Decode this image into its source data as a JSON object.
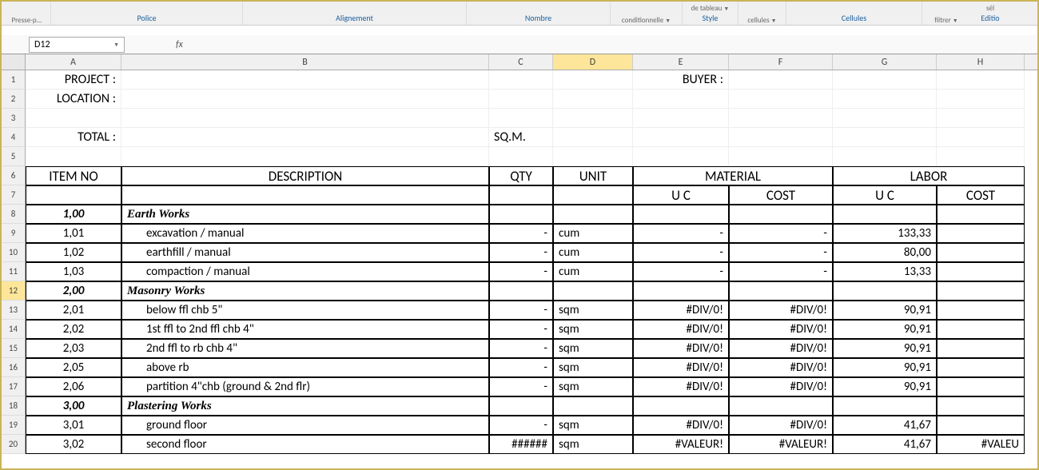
{
  "ribbon": {
    "groups": [
      {
        "top": "Presse-p...",
        "label": ""
      },
      {
        "label": "Police"
      },
      {
        "label": "Alignement"
      },
      {
        "label": "Nombre"
      },
      {
        "top": "conditionnelle",
        "label": ""
      },
      {
        "top": "de tableau",
        "label": "Style"
      },
      {
        "top": "cellules",
        "label": ""
      },
      {
        "label": "Cellules"
      },
      {
        "top": "filtrer",
        "label": ""
      },
      {
        "top": "sél",
        "label": "Editio"
      }
    ]
  },
  "namebox": "D12",
  "fx": "fx",
  "columns": [
    "A",
    "B",
    "C",
    "D",
    "E",
    "F",
    "G",
    "H"
  ],
  "active_col": "D",
  "active_row": 12,
  "header_labels": {
    "project": "PROJECT :",
    "buyer": "BUYER :",
    "location": "LOCATION :",
    "total": "TOTAL :",
    "sqm": "SQ.M."
  },
  "table_headers": {
    "item_no": "ITEM NO",
    "description": "DESCRIPTION",
    "qty": "QTY",
    "unit": "UNIT",
    "material": "MATERIAL",
    "labor": "LABOR",
    "uc": "U C",
    "cost": "COST"
  },
  "rows": [
    {
      "n": "1",
      "a": "PROJECT :",
      "e": "BUYER :"
    },
    {
      "n": "2",
      "a": "LOCATION :"
    },
    {
      "n": "3"
    },
    {
      "n": "4",
      "a": "TOTAL :",
      "c": "SQ.M."
    },
    {
      "n": "5"
    },
    {
      "n": "6",
      "hdr1": true
    },
    {
      "n": "7",
      "hdr2": true
    },
    {
      "n": "8",
      "a": "1,00",
      "b": "Earth Works",
      "section": true
    },
    {
      "n": "9",
      "a": "1,01",
      "b": "excavation / manual",
      "c": "-",
      "d": "cum",
      "e": "-",
      "f": "-",
      "g": "133,33"
    },
    {
      "n": "10",
      "a": "1,02",
      "b": "earthfill / manual",
      "c": "-",
      "d": "cum",
      "e": "-",
      "f": "-",
      "g": "80,00"
    },
    {
      "n": "11",
      "a": "1,03",
      "b": "compaction / manual",
      "c": "-",
      "d": "cum",
      "e": "-",
      "f": "-",
      "g": "13,33"
    },
    {
      "n": "12",
      "a": "2,00",
      "b": "Masonry Works",
      "section": true,
      "active": true
    },
    {
      "n": "13",
      "a": "2,01",
      "b": "below ffl chb 5\"",
      "c": "-",
      "d": "sqm",
      "e": "#DIV/0!",
      "f": "#DIV/0!",
      "g": "90,91"
    },
    {
      "n": "14",
      "a": "2,02",
      "b": "1st ffl to 2nd ffl  chb 4\"",
      "c": "-",
      "d": "sqm",
      "e": "#DIV/0!",
      "f": "#DIV/0!",
      "g": "90,91"
    },
    {
      "n": "15",
      "a": "2,03",
      "b": "2nd ffl to rb chb 4\"",
      "c": "-",
      "d": "sqm",
      "e": "#DIV/0!",
      "f": "#DIV/0!",
      "g": "90,91"
    },
    {
      "n": "16",
      "a": "2,05",
      "b": "above rb",
      "c": "-",
      "d": "sqm",
      "e": "#DIV/0!",
      "f": "#DIV/0!",
      "g": "90,91"
    },
    {
      "n": "17",
      "a": "2,06",
      "b": "partition 4\"chb (ground & 2nd flr)",
      "c": "-",
      "d": "sqm",
      "e": "#DIV/0!",
      "f": "#DIV/0!",
      "g": "90,91"
    },
    {
      "n": "18",
      "a": "3,00",
      "b": "Plastering Works",
      "section": true
    },
    {
      "n": "19",
      "a": "3,01",
      "b": "ground floor",
      "c": "-",
      "d": "sqm",
      "e": "#DIV/0!",
      "f": "#DIV/0!",
      "g": "41,67"
    },
    {
      "n": "20",
      "a": "3,02",
      "b": "second floor",
      "c": "######",
      "d": "sqm",
      "e": "#VALEUR!",
      "f": "#VALEUR!",
      "g": "41,67",
      "h": "#VALEU"
    }
  ]
}
